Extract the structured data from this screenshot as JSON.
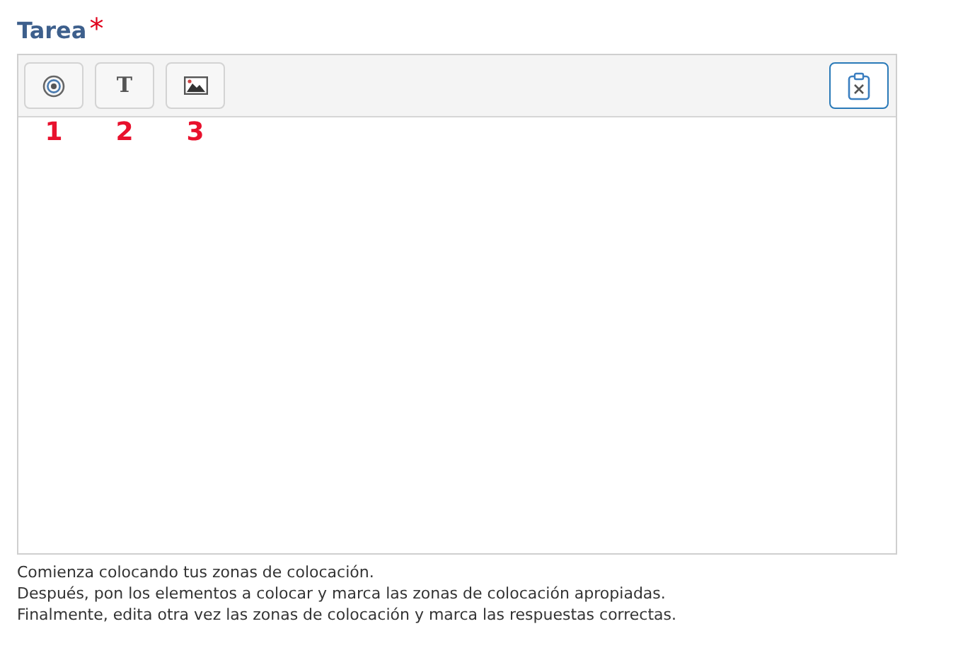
{
  "label": {
    "text": "Tarea",
    "required_mark": "*"
  },
  "toolbar": {
    "buttons": [
      {
        "kind": "target",
        "annotation": "1"
      },
      {
        "kind": "text",
        "glyph": "T",
        "annotation": "2"
      },
      {
        "kind": "image",
        "annotation": "3"
      }
    ],
    "right_button": {
      "kind": "clear"
    }
  },
  "help_lines": [
    "Comienza colocando tus zonas de colocación.",
    "Después, pon los elementos a colocar y marca las zonas de colocación apropiadas.",
    "Finalmente, edita otra vez las zonas de colocación y marca las respuestas correctas."
  ]
}
